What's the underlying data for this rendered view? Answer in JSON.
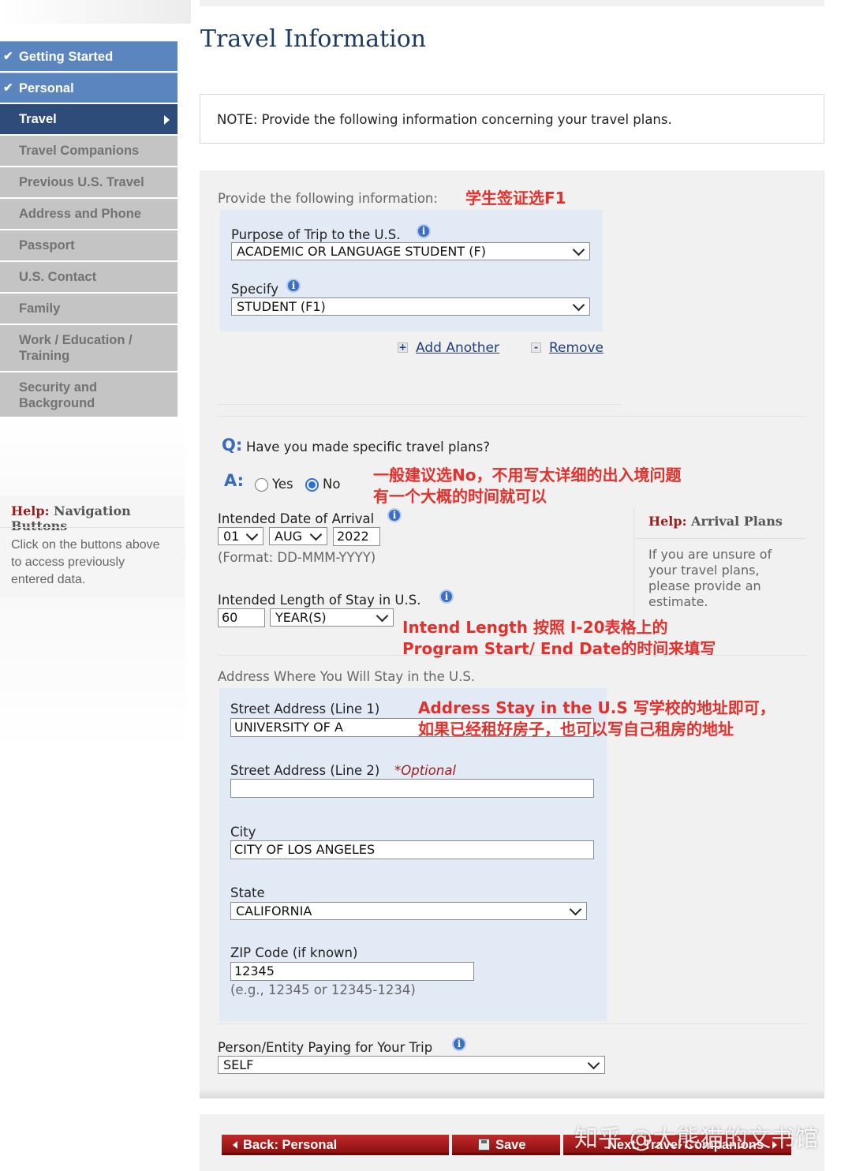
{
  "nav": {
    "items": [
      {
        "label": "Getting Started",
        "state": "done"
      },
      {
        "label": "Personal",
        "state": "done"
      },
      {
        "label": "Travel",
        "state": "active"
      },
      {
        "label": "Travel Companions",
        "state": "todo"
      },
      {
        "label": "Previous U.S. Travel",
        "state": "todo"
      },
      {
        "label": "Address and Phone",
        "state": "todo"
      },
      {
        "label": "Passport",
        "state": "todo"
      },
      {
        "label": "U.S. Contact",
        "state": "todo"
      },
      {
        "label": "Family",
        "state": "todo"
      },
      {
        "label": "Work / Education / Training",
        "state": "todo"
      },
      {
        "label": "Security and Background",
        "state": "todo"
      }
    ],
    "check_glyph": "✔"
  },
  "help_nav": {
    "prefix": "Help:",
    "title": "Navigation Buttons",
    "body": "Click on the buttons above to access previously entered data."
  },
  "page": {
    "title": "Travel Information",
    "note": "NOTE: Provide the following information concerning your travel plans."
  },
  "purpose": {
    "intro": "Provide the following information:",
    "annotation": "学生签证选F1",
    "purpose_label": "Purpose of Trip to the U.S.",
    "purpose_value": "ACADEMIC OR LANGUAGE STUDENT (F)",
    "specify_label": "Specify",
    "specify_value": "STUDENT (F1)",
    "add_another": "Add Another",
    "remove": "Remove",
    "add_glyph": "+",
    "remove_glyph": "-"
  },
  "plans": {
    "q_prefix": "Q:",
    "question": "Have you made specific travel plans?",
    "a_prefix": "A:",
    "yes_label": "Yes",
    "no_label": "No",
    "selected": "No",
    "annotation_line1": "一般建议选No，不用写太详细的出入境问题",
    "annotation_line2": "有一个大概的时间就可以"
  },
  "arrival": {
    "label": "Intended Date of Arrival",
    "day": "01",
    "month": "AUG",
    "year": "2022",
    "format_hint": "(Format: DD-MMM-YYYY)"
  },
  "help_arrival": {
    "prefix": "Help:",
    "title": "Arrival Plans",
    "body": "If you are unsure of your travel plans, please provide an estimate."
  },
  "stay": {
    "label": "Intended Length of Stay in U.S.",
    "value": "60",
    "unit": "YEAR(S)",
    "annotation_line1": "Intend Length 按照 I-20表格上的",
    "annotation_line2": "Program Start/ End Date的时间来填写"
  },
  "address": {
    "section_label": "Address Where You Will Stay in the U.S.",
    "line1_label": "Street Address (Line 1)",
    "line1_value": "UNIVERSITY OF A",
    "line2_label": "Street Address (Line 2)",
    "line2_optional": "*Optional",
    "line2_value": "",
    "city_label": "City",
    "city_value": "CITY OF LOS ANGELES",
    "state_label": "State",
    "state_value": "CALIFORNIA",
    "zip_label": "ZIP Code (if known)",
    "zip_value": "12345",
    "zip_hint": "(e.g., 12345 or 12345-1234)",
    "annotation_line1": "Address Stay in the U.S 写学校的地址即可，",
    "annotation_line2": "如果已经租好房子，也可以写自己租房的地址"
  },
  "payer": {
    "label": "Person/Entity Paying for Your Trip",
    "value": "SELF"
  },
  "buttons": {
    "back": "Back: Personal",
    "save": "Save",
    "next": "Next: Travel Companions"
  },
  "watermark": "知乎 @大熊猫的文书馆",
  "colors": {
    "nav_done": "#5a85bf",
    "nav_active": "#2e4c7a",
    "nav_todo": "#c4c4c4",
    "title": "#1d3a63",
    "annotation": "#e2302c",
    "button": "#a81c1c"
  }
}
